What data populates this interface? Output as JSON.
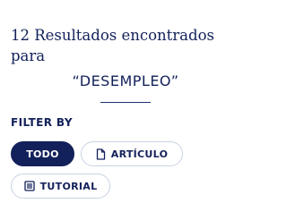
{
  "results": {
    "title": "12 Resultados encontrados para",
    "search_term": "“DESEMPLEO”"
  },
  "filters": {
    "label": "FILTER BY",
    "options": [
      {
        "label": "TODO",
        "icon": "",
        "active": true
      },
      {
        "label": "ARTÍCULO",
        "icon": "document-icon",
        "active": false
      },
      {
        "label": "TUTORIAL",
        "icon": "list-icon",
        "active": false
      }
    ]
  },
  "colors": {
    "primary": "#13215a",
    "chip_border": "#c9d1e6",
    "background": "#ffffff"
  }
}
